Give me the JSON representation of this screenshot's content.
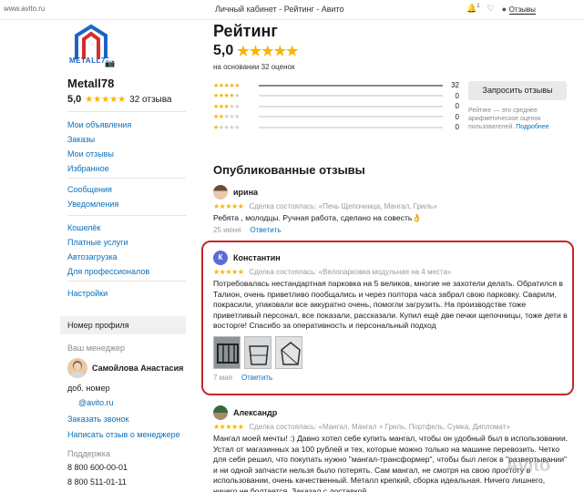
{
  "browser": {
    "url": "www.avito.ru",
    "title": "Личный кабинет - Рейтинг - Авито",
    "reviews_label": "Отзывы",
    "notif_count": "1"
  },
  "seller": {
    "logo_text": "METALL78",
    "name": "Metall78",
    "rating": "5,0",
    "reviews_count": "32 отзыва"
  },
  "left_nav": {
    "group1": [
      "Мои объявления",
      "Заказы",
      "Мои отзывы",
      "Избранное"
    ],
    "group2": [
      "Сообщения",
      "Уведомления"
    ],
    "group3": [
      "Кошелёк",
      "Платные услуги",
      "Автозагрузка",
      "Для профессионалов"
    ],
    "group4": [
      "Настройки"
    ],
    "profile_number": "Номер профиля",
    "manager_label": "Ваш менеджер",
    "manager_name": "Самойлова Анастасия",
    "ext_label": "доб. номер",
    "email": "@avito.ru",
    "order_call": "Заказать звонок",
    "write_review": "Написать отзыв о менеджере",
    "support_label": "Поддержка",
    "phone1": "8 800 600-00-01",
    "phone2": "8 800 511-01-11"
  },
  "rating": {
    "heading": "Рейтинг",
    "value": "5,0",
    "based_on": "на основании 32 оценок",
    "distribution": [
      {
        "stars": 5,
        "count": 32,
        "fraction": 1.0
      },
      {
        "stars": 4,
        "count": 0,
        "fraction": 0
      },
      {
        "stars": 3,
        "count": 0,
        "fraction": 0
      },
      {
        "stars": 2,
        "count": 0,
        "fraction": 0
      },
      {
        "stars": 1,
        "count": 0,
        "fraction": 0
      }
    ],
    "ask_button": "Запросить отзывы",
    "note": "Рейтинг — это среднее арифметическое оценок пользователей.",
    "note_link": "Подробнее"
  },
  "reviews": {
    "heading": "Опубликованные отзывы",
    "items": [
      {
        "author": "ирина",
        "deal": "Сделка состоялась: «Печь Щепочница, Мангал, Гриль»",
        "text": "Ребята , молодцы. Ручная работа, сделано на совесть👌",
        "date": "25 июня",
        "reply": "Ответить"
      },
      {
        "author": "Константин",
        "initial": "К",
        "deal": "Сделка состоялась: «Велопарковка модульная на 4 места»",
        "text": "Потребовалась нестандартная парковка на 5 великов, многие не захотели делать. Обратился в Талион, очень приветливо пообщались и через полтора часа забрал свою парковку. Сварили, покрасили, упаковали все аккуратно очень, помогли загрузить. На производстве тоже приветливый персонал, все показали, рассказали. Купил ещё две печки щепочницы, тоже дети в восторге! Спасибо за оперативность и персональный подход",
        "date": "7 мая",
        "reply": "Ответить"
      },
      {
        "author": "Александр",
        "deal": "Сделка состоялась: «Мангал, Мангал + Гриль, Портфель, Сумка, Дипломат»",
        "text": "Мангал моей мечты! :) Давно хотел себе купить мангал, чтобы он удобный был в использовании. Устал от магазинных за 100 рублей и тех, которые можно только на машине перевозить. Четко для себя решил, что покупать нужно \"мангал-трансформер\", чтобы был легок в \"развертывании\" и ни одной запчасти нельзя было потерять. Сам мангал, не смотря на свою простоту в использовании, очень качественный. Металл крепкий, сборка идеальная. Ничего лишнего, ничего не болтается. Заказал с доставкой.",
        "date": "",
        "reply": ""
      }
    ]
  },
  "colors": {
    "star": "#f7b500",
    "link": "#0a6fb8",
    "highlight": "#c62828"
  }
}
